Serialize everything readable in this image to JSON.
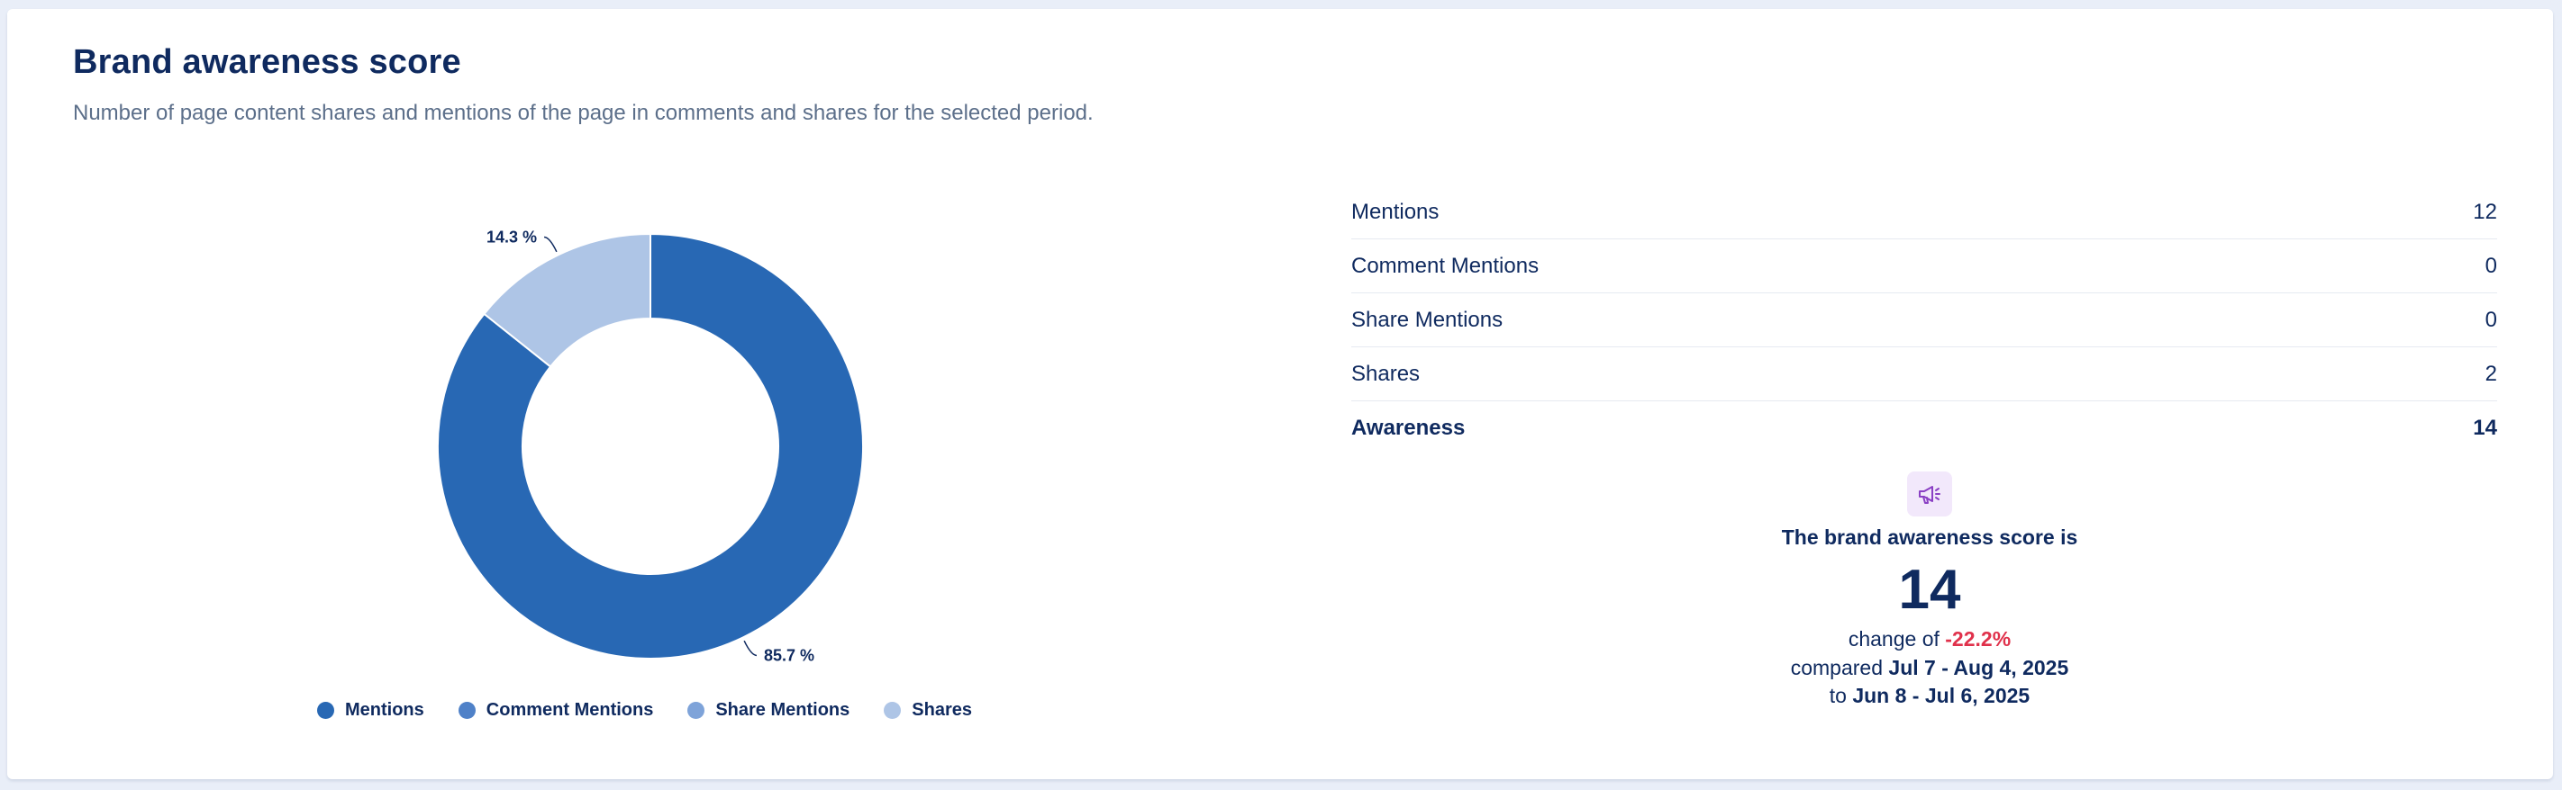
{
  "header": {
    "title": "Brand awareness score",
    "subtitle": "Number of page content shares and mentions of the page in comments and shares for the selected period."
  },
  "chart_data": {
    "type": "pie",
    "donut": true,
    "categories": [
      "Mentions",
      "Comment Mentions",
      "Share Mentions",
      "Shares"
    ],
    "values": [
      12,
      0,
      0,
      2
    ],
    "percent_labels": [
      "85.7 %",
      "",
      "",
      "14.3 %"
    ],
    "colors": [
      "#2868b4",
      "#4f81c8",
      "#7ea3d9",
      "#aec5e6"
    ],
    "legend_position": "bottom"
  },
  "legend": [
    {
      "label": "Mentions",
      "color": "#2868b4"
    },
    {
      "label": "Comment Mentions",
      "color": "#4f81c8"
    },
    {
      "label": "Share Mentions",
      "color": "#7ea3d9"
    },
    {
      "label": "Shares",
      "color": "#aec5e6"
    }
  ],
  "metrics": [
    {
      "label": "Mentions",
      "value": "12"
    },
    {
      "label": "Comment Mentions",
      "value": "0"
    },
    {
      "label": "Share Mentions",
      "value": "0"
    },
    {
      "label": "Shares",
      "value": "2"
    },
    {
      "label": "Awareness",
      "value": "14"
    }
  ],
  "score": {
    "icon": "megaphone-icon",
    "label": "The brand awareness score is",
    "value": "14",
    "change_prefix": "change of ",
    "change_value": "-22.2%",
    "compared_prefix": "compared ",
    "current_period": "Jul 7 - Aug 4, 2025",
    "to_prefix": "to ",
    "previous_period": "Jun 8 - Jul 6, 2025"
  }
}
